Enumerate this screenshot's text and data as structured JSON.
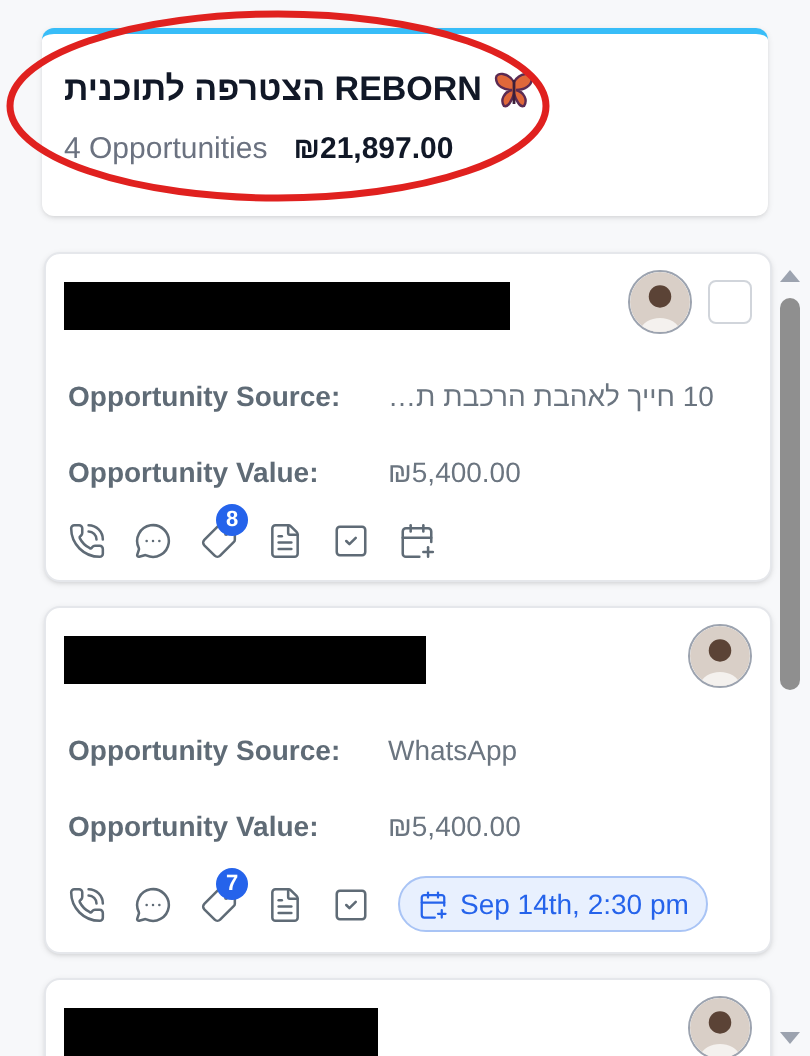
{
  "header": {
    "title": "הצטרפה לתוכנית REBORN",
    "count": "4 Opportunities",
    "total": "₪21,897.00"
  },
  "opportunities": [
    {
      "kind": "full",
      "checkbox": {
        "checked": false
      },
      "fields": [
        {
          "label": "Opportunity Source:",
          "value": "10 חייך לאהבת הרכבת ת…"
        },
        {
          "label": "Opportunity Value:",
          "value": "₪5,400.00"
        }
      ],
      "tag_count": "8",
      "calendar": {
        "kind": "add"
      }
    },
    {
      "kind": "full",
      "fields": [
        {
          "label": "Opportunity Source:",
          "value": "WhatsApp"
        },
        {
          "label": "Opportunity Value:",
          "value": "₪5,400.00"
        }
      ],
      "tag_count": "7",
      "calendar": {
        "kind": "appointment",
        "label": "Sep 14th, 2:30 pm"
      }
    },
    {
      "kind": "cut"
    }
  ]
}
